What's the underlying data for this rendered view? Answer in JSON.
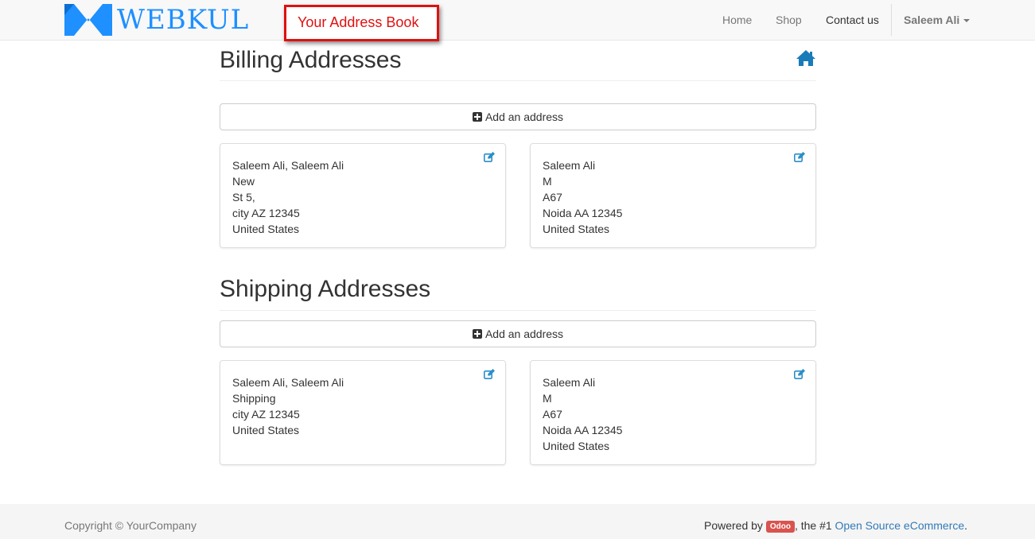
{
  "brand": {
    "name": "WEBKUL",
    "accent": "#1e90ff"
  },
  "annotation": {
    "text": "Your Address Book",
    "color": "#e01010"
  },
  "nav": {
    "items": [
      "Home",
      "Shop",
      "Contact us"
    ],
    "user": "Saleem Ali"
  },
  "billing": {
    "title": "Billing Addresses",
    "add_label": "Add an address",
    "cards": [
      {
        "lines": [
          "Saleem Ali, Saleem Ali",
          "New",
          "St 5,",
          "city AZ 12345",
          "United States"
        ]
      },
      {
        "lines": [
          "Saleem Ali",
          "M",
          "A67",
          "Noida AA 12345",
          "United States"
        ]
      }
    ]
  },
  "shipping": {
    "title": "Shipping Addresses",
    "add_label": "Add an address",
    "cards": [
      {
        "lines": [
          "Saleem Ali, Saleem Ali",
          "Shipping",
          "city AZ 12345",
          "United States"
        ]
      },
      {
        "lines": [
          "Saleem Ali",
          "M",
          "A67",
          "Noida AA 12345",
          "United States"
        ]
      }
    ]
  },
  "footer": {
    "copyright": "Copyright © YourCompany",
    "powered_prefix": "Powered by",
    "odoo_badge": "Odoo",
    "powered_mid": ", the #1",
    "powered_link": "Open Source eCommerce",
    "powered_suffix": "."
  },
  "icons": {
    "home": "home-icon",
    "edit": "edit-icon",
    "add": "plus-square-icon",
    "caret": "caret-down-icon"
  },
  "colors": {
    "link": "#337ab7",
    "icon": "#2a8fc9"
  }
}
